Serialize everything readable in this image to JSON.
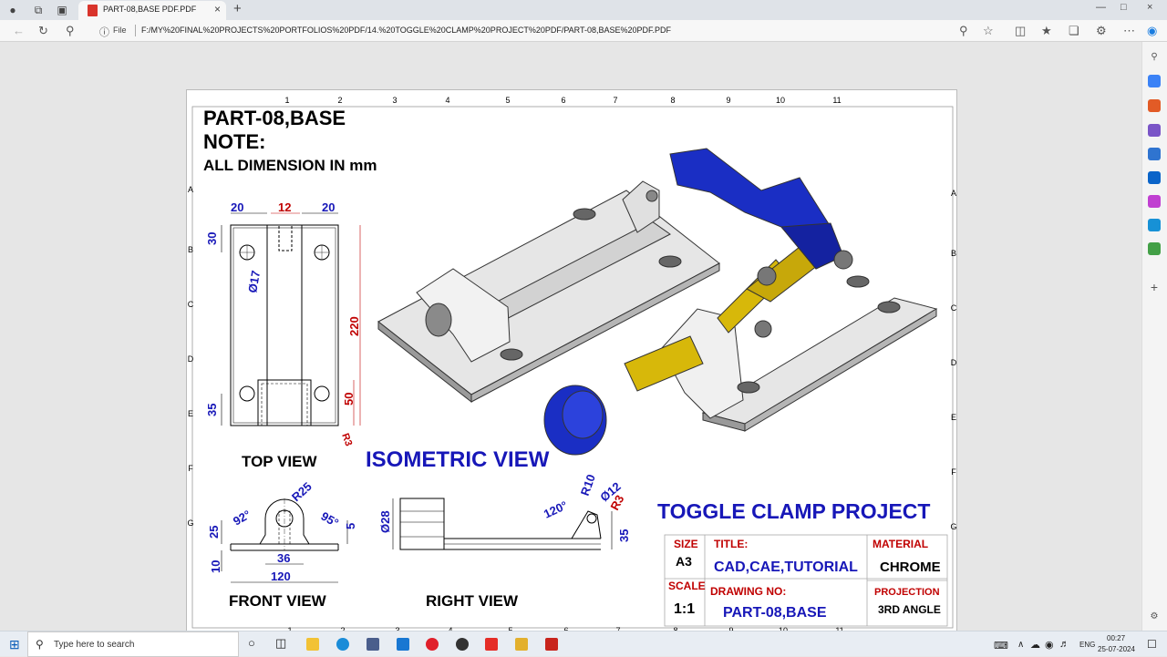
{
  "browser": {
    "tab_title": "PART-08,BASE PDF.PDF",
    "file_label": "File",
    "url": "F:/MY%20FINAL%20PROJECTS%20PORTFOLIOS%20PDF/14.%20TOGGLE%20CLAMP%20PROJECT%20PDF/PART-08,BASE%20PDF.PDF"
  },
  "drawing": {
    "heading": "PART-08,BASE",
    "note_label": "NOTE:",
    "note_text": "ALL DIMENSION IN mm",
    "views": {
      "top": "TOP VIEW",
      "isometric": "ISOMETRIC VIEW",
      "front": "FRONT VIEW",
      "right": "RIGHT VIEW"
    },
    "border_cols": [
      "1",
      "2",
      "3",
      "4",
      "5",
      "6",
      "7",
      "8",
      "9",
      "10",
      "11"
    ],
    "border_rows": [
      "A",
      "B",
      "C",
      "D",
      "E",
      "F",
      "G"
    ],
    "top_dims": {
      "w1": "20",
      "slot": "12",
      "w2": "20",
      "d30": "30",
      "hole": "Ø17",
      "len": "220",
      "d35": "35",
      "d50": "50",
      "r3": "R3"
    },
    "front_dims": {
      "r25": "R25",
      "a92": "92°",
      "a95": "95°",
      "h25": "25",
      "t10": "10",
      "w36": "36",
      "w120": "120",
      "t5": "5"
    },
    "right_dims": {
      "d28": "Ø28",
      "a120": "120°",
      "r10": "R10",
      "d12": "Ø12",
      "r3": "R3",
      "h35": "35"
    },
    "project_title": "TOGGLE CLAMP PROJECT",
    "title_block": {
      "size_label": "SIZE",
      "size_value": "A3",
      "title_label": "TITLE:",
      "title_value": "CAD,CAE,TUTORIAL",
      "material_label": "MATERIAL",
      "material_value": "CHROME",
      "scale_label": "SCALE",
      "scale_value": "1:1",
      "drawing_no_label": "DRAWING NO:",
      "drawing_no_value": "PART-08,BASE",
      "projection_label": "PROJECTION",
      "projection_value": "3RD ANGLE"
    }
  },
  "taskbar": {
    "search_placeholder": "Type here to search",
    "lang": "ENG",
    "time": "00:27",
    "date": "25-07-2024"
  },
  "colors": {
    "blue": "#1717b8",
    "red": "#c00000",
    "chrome": "#d6d6d6",
    "brass": "#d7b80a"
  }
}
